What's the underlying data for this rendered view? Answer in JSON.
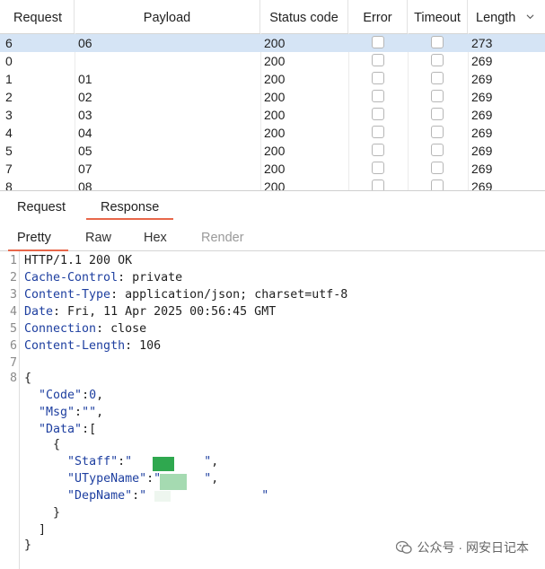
{
  "table": {
    "headers": {
      "request": "Request",
      "payload": "Payload",
      "status": "Status code",
      "error": "Error",
      "timeout": "Timeout",
      "length": "Length"
    },
    "rows": [
      {
        "request": "6",
        "payload": "06",
        "status": "200",
        "length": "273",
        "selected": true
      },
      {
        "request": "0",
        "payload": "",
        "status": "200",
        "length": "269",
        "selected": false
      },
      {
        "request": "1",
        "payload": "01",
        "status": "200",
        "length": "269",
        "selected": false
      },
      {
        "request": "2",
        "payload": "02",
        "status": "200",
        "length": "269",
        "selected": false
      },
      {
        "request": "3",
        "payload": "03",
        "status": "200",
        "length": "269",
        "selected": false
      },
      {
        "request": "4",
        "payload": "04",
        "status": "200",
        "length": "269",
        "selected": false
      },
      {
        "request": "5",
        "payload": "05",
        "status": "200",
        "length": "269",
        "selected": false
      },
      {
        "request": "7",
        "payload": "07",
        "status": "200",
        "length": "269",
        "selected": false
      },
      {
        "request": "8",
        "payload": "08",
        "status": "200",
        "length": "269",
        "selected": false
      }
    ],
    "sort_icon": "chevron-down-icon"
  },
  "tabs": {
    "request": "Request",
    "response": "Response"
  },
  "subtabs": {
    "pretty": "Pretty",
    "raw": "Raw",
    "hex": "Hex",
    "render": "Render"
  },
  "response": {
    "status_line": "HTTP/1.1 200 OK",
    "headers": [
      {
        "name": "Cache-Control",
        "value": "private"
      },
      {
        "name": "Content-Type",
        "value": "application/json; charset=utf-8"
      },
      {
        "name": "Date",
        "value": "Fri, 11 Apr 2025 00:56:45 GMT"
      },
      {
        "name": "Connection",
        "value": "close"
      },
      {
        "name": "Content-Length",
        "value": "106"
      }
    ],
    "body": {
      "code_key": "\"Code\"",
      "code_val": "0",
      "msg_key": "\"Msg\"",
      "msg_val": "\"\"",
      "data_key": "\"Data\"",
      "staff_key": "\"Staff\"",
      "staff_val": "\"",
      "utype_key": "\"UTypeName\"",
      "utype_val": "\"",
      "dep_key": "\"DepName\"",
      "dep_val": "\""
    }
  },
  "watermark": {
    "text": "公众号 · 网安日记本",
    "icon": "wechat-icon"
  },
  "colors": {
    "selected_row": "#d5e4f5",
    "accent": "#e8674a",
    "header_name": "#1e3fa0"
  }
}
